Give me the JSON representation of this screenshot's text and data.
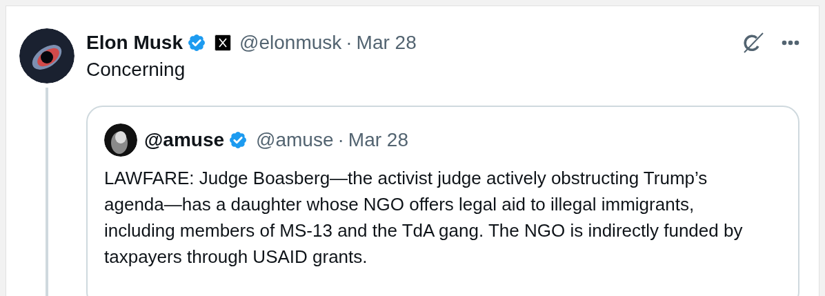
{
  "tweet": {
    "name": "Elon Musk",
    "verified": true,
    "handle": "@elonmusk",
    "separator": "·",
    "date": "Mar 28",
    "text": "Concerning",
    "quote": {
      "name": "@amuse",
      "verified": true,
      "handle": "@amuse",
      "separator": "·",
      "date": "Mar 28",
      "text": "LAWFARE: Judge Boasberg—the activist judge actively obstructing Trump’s agenda—has a daughter whose NGO offers legal aid to illegal immigrants, including members of MS-13 and the TdA gang. The NGO is indirectly funded by taxpayers through USAID grants."
    }
  }
}
